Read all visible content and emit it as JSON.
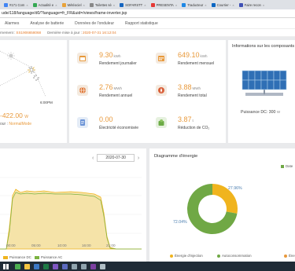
{
  "browser": {
    "tabs": [
      {
        "label": "#171 Com",
        "color": "#4285f4"
      },
      {
        "label": "Actualité e",
        "color": "#34a853"
      },
      {
        "label": "Météociel",
        "color": "#e8a23a"
      },
      {
        "label": "Toilettes sè",
        "color": "#888888"
      },
      {
        "label": "SOFARSTT",
        "color": "#1565c0"
      },
      {
        "label": "PRESENTA",
        "color": "#e53935"
      },
      {
        "label": "Traducteur",
        "color": "#1e88e5"
      },
      {
        "label": "Courrier -",
        "color": "#0a66c2"
      },
      {
        "label": "Faire recon",
        "color": "#3f51b5"
      }
    ],
    "url": "ude/118/language/d0/?language=fr_FR&uid=/views/frame-inverter.jsp"
  },
  "nav": {
    "items": [
      "Alarmes",
      "Analyse de batterie",
      "Données de l'onduleur",
      "Rapport statistique"
    ]
  },
  "info": {
    "serial_label": "rnement :",
    "serial_value": "SS1906658068",
    "update_label": "Dernière mise à jour :",
    "update_value": "2020-07-31 16:12:04"
  },
  "flow": {
    "time": "6:00PM",
    "power": "-422.00",
    "power_unit": "W",
    "state_label": "our :",
    "state_value": "NormalMode"
  },
  "stats": [
    {
      "value": "9.30",
      "unit": "kWh",
      "label": "Rendement journalier",
      "icon": "calendar-day-icon"
    },
    {
      "value": "649.10",
      "unit": "kWh",
      "label": "Rendement mensuel",
      "icon": "calendar-month-icon"
    },
    {
      "value": "2.76",
      "unit": "MWh",
      "label": "Rendement annuel",
      "icon": "globe-icon"
    },
    {
      "value": "3.88",
      "unit": "MWh",
      "label": "Rendement total",
      "icon": "gauge-icon"
    },
    {
      "value": "0.00",
      "unit": "",
      "label": "Électricité économisée",
      "icon": "document-icon"
    },
    {
      "value": "3.87",
      "unit": "t",
      "label": "Réduction de CO₂",
      "icon": "leaf-icon"
    }
  ],
  "component": {
    "title": "Informations sur les composants",
    "power_label": "Puissance DC:",
    "power_value": "300",
    "power_unit": "W"
  },
  "curve": {
    "date": "2020-07-30",
    "prev": "‹",
    "next": "›",
    "x_ticks": [
      "00:00",
      "05:00",
      "10:00",
      "16:00",
      "21:00"
    ],
    "legend": [
      {
        "label": "Puissance DC",
        "color": "#f0b41e"
      },
      {
        "label": "Puissance AC",
        "color": "#7cb342"
      }
    ]
  },
  "energy": {
    "title": "Diagramme d'énergie",
    "top_legend": "Date",
    "slices": [
      {
        "label": "Autoconsommation",
        "pct": "72.04%",
        "value": 72.04,
        "color": "#70a845"
      },
      {
        "label": "Énergie d'injection",
        "pct": "27.96%",
        "value": 27.96,
        "color": "#f0b41e"
      }
    ],
    "legend": [
      {
        "label": "Énergie d'injection",
        "color": "#f0b41e"
      },
      {
        "label": "Autoconsommation",
        "color": "#70a845"
      },
      {
        "label": "Éne",
        "color": "#e8993b"
      }
    ]
  },
  "taskbar": {
    "icons": [
      {
        "name": "chrome-icon",
        "color": "#4caf50"
      },
      {
        "name": "explorer-icon",
        "color": "#f5c542"
      },
      {
        "name": "app-icon",
        "color": "#3b78c4"
      },
      {
        "name": "excel-icon",
        "color": "#1d7a45"
      },
      {
        "name": "app2-icon",
        "color": "#7e57c2"
      },
      {
        "name": "app3-icon",
        "color": "#5c6bc0"
      },
      {
        "name": "app4-icon",
        "color": "#90a4ae"
      },
      {
        "name": "app5-icon",
        "color": "#90a4ae"
      },
      {
        "name": "onenote-icon",
        "color": "#7b3fa0"
      },
      {
        "name": "app6-icon",
        "color": "#b0bec5"
      }
    ]
  }
}
